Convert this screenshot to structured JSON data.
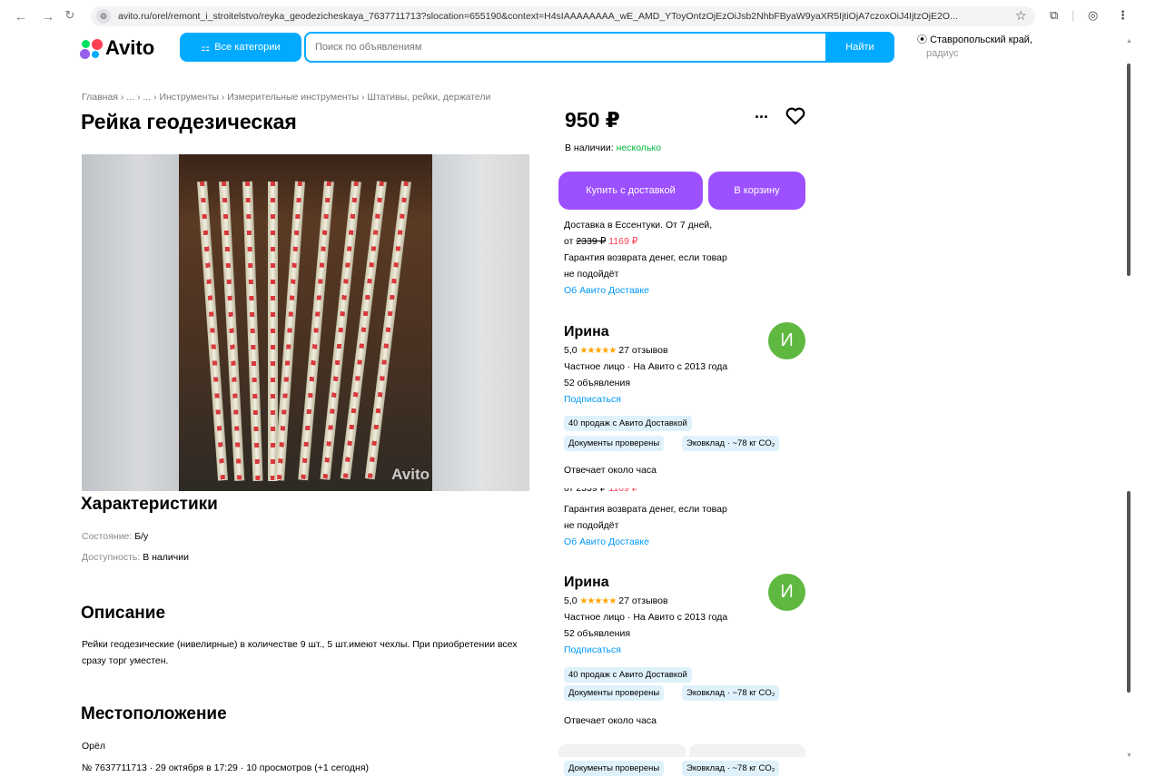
{
  "browser": {
    "url": "avito.ru/orel/remont_i_stroitelstvo/reyka_geodezicheskaya_7637711713?slocation=655190&context=H4sIAAAAAAAA_wE_AMD_YToyOntzOjEzOiJsb2NhbFByaW9yaXR5IjtiOjA7czoxOiJ4IjtzOjE2O..."
  },
  "header": {
    "logo_text": "Avito",
    "categories_label": "Все категории",
    "search_placeholder": "Поиск по объявлениям",
    "search_button": "Найти",
    "region": "Ставропольский край,",
    "region_sub": "радиус"
  },
  "breadcrumb": "Главная › ... › ... › Инструменты › Измерительные инструменты › Штативы, рейки, держатели",
  "listing": {
    "title": "Рейка геодезическая",
    "watermark": "Avito",
    "characteristics_title": "Характеристики",
    "condition_key": "Состояние:",
    "condition_value": "Б/у",
    "availability_key": "Доступность:",
    "availability_value": "В наличии",
    "description_title": "Описание",
    "description": "Рейки геодезические (нивелирные) в количестве 9 шт., 5 шт.имеют чехлы. При приобретении всех сразу торг уместен.",
    "location_title": "Местоположение",
    "city": "Орёл",
    "meta": "№ 7637711713 · 29 октября в 17:29 · 10 просмотров (+1 сегодня)"
  },
  "offer": {
    "price": "950 ₽",
    "stock_label": "В наличии:",
    "stock_value": "несколько",
    "buy_button": "Купить с доставкой",
    "cart_button": "В корзину",
    "delivery_line": "Доставка в Ессентуки. От 7 дней,",
    "price_from": "от",
    "old_price": "2339 ₽",
    "new_price": "1169 ₽",
    "guarantee_1": "Гарантия возврата денег, если товар",
    "guarantee_2": "не подойдёт",
    "delivery_link": "Об Авито Доставке"
  },
  "seller": {
    "name": "Ирина",
    "avatar_letter": "И",
    "rating": "5,0",
    "stars": "★★★★★",
    "reviews": "27 отзывов",
    "info": "Частное лицо · На Авито с 2013 года",
    "ads": "52 объявления",
    "subscribe": "Подписаться",
    "badge_sales": "40 продаж с Авито Доставкой",
    "badge_docs": "Документы проверены",
    "badge_eco": "Эковклад · ~78 кг CO₂",
    "response": "Отвечает около часа"
  },
  "colors": {
    "accent": "#00aaff",
    "purple": "#9d50ff",
    "green": "#02b93c",
    "red": "#ff4053",
    "link": "#0099f7",
    "avatar": "#5fb840"
  }
}
